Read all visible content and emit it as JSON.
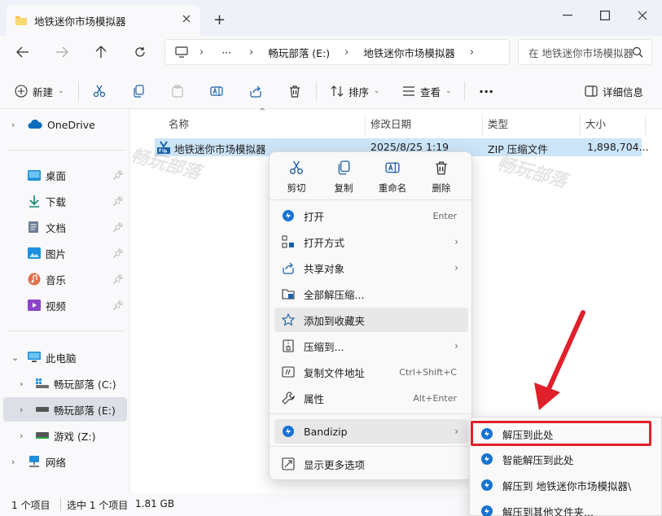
{
  "window": {
    "tab_title": "地铁迷你市场模拟器",
    "new_tab": "+"
  },
  "nav": {
    "more": "···",
    "crumbs": [
      "畅玩部落 (E:)",
      "地铁迷你市场模拟器"
    ],
    "search_placeholder": "在 地铁迷你市场模拟器 中搜索"
  },
  "toolbar": {
    "new": "新建",
    "sort": "排序",
    "view": "查看",
    "more": "···",
    "details": "详细信息"
  },
  "sidebar": {
    "onedrive": "OneDrive",
    "quick": [
      {
        "label": "桌面",
        "icon": "desktop-icon"
      },
      {
        "label": "下载",
        "icon": "download-icon"
      },
      {
        "label": "文档",
        "icon": "document-icon"
      },
      {
        "label": "图片",
        "icon": "picture-icon"
      },
      {
        "label": "音乐",
        "icon": "music-icon"
      },
      {
        "label": "视频",
        "icon": "video-icon"
      }
    ],
    "this_pc": "此电脑",
    "drives": [
      "畅玩部落 (C:)",
      "畅玩部落 (E:)",
      "游戏 (Z:)"
    ],
    "network": "网络"
  },
  "columns": {
    "name": "名称",
    "date": "修改日期",
    "type": "类型",
    "size": "大小"
  },
  "file": {
    "name": "地铁迷你市场模拟器",
    "date": "2025/8/25 1:19",
    "type": "ZIP 压缩文件",
    "size": "1,898,704..."
  },
  "status": {
    "count": "1 个项目",
    "selected": "选中 1 个项目",
    "size": "1.81 GB"
  },
  "context_menu": {
    "top": [
      {
        "label": "剪切",
        "icon": "scissors-icon"
      },
      {
        "label": "复制",
        "icon": "copy-icon"
      },
      {
        "label": "重命名",
        "icon": "rename-icon"
      },
      {
        "label": "删除",
        "icon": "trash-icon"
      }
    ],
    "items": [
      {
        "label": "打开",
        "shortcut": "Enter",
        "icon": "bandizip-icon"
      },
      {
        "label": "打开方式",
        "shortcut": "",
        "icon": "open-with-icon"
      },
      {
        "label": "共享对象",
        "shortcut": "",
        "icon": "share-icon"
      },
      {
        "label": "全部解压缩...",
        "shortcut": "",
        "icon": "extract-all-icon"
      },
      {
        "label": "添加到收藏夹",
        "shortcut": "",
        "icon": "star-icon"
      },
      {
        "label": "压缩到...",
        "shortcut": "",
        "icon": "compress-icon"
      },
      {
        "label": "复制文件地址",
        "shortcut": "Ctrl+Shift+C",
        "icon": "copy-path-icon"
      },
      {
        "label": "属性",
        "shortcut": "Alt+Enter",
        "icon": "wrench-icon"
      }
    ],
    "bandizip": "Bandizip",
    "more_options": "显示更多选项"
  },
  "submenu": {
    "items": [
      "解压到此处",
      "智能解压到此处",
      "解压到 地铁迷你市场模拟器\\",
      "解压到其他文件夹..."
    ]
  },
  "watermark": "畅玩部落",
  "colors": {
    "accent": "#0067c0",
    "selection": "#cce4f7",
    "highlight_border": "#e0202a",
    "arrow": "#e0202a"
  }
}
